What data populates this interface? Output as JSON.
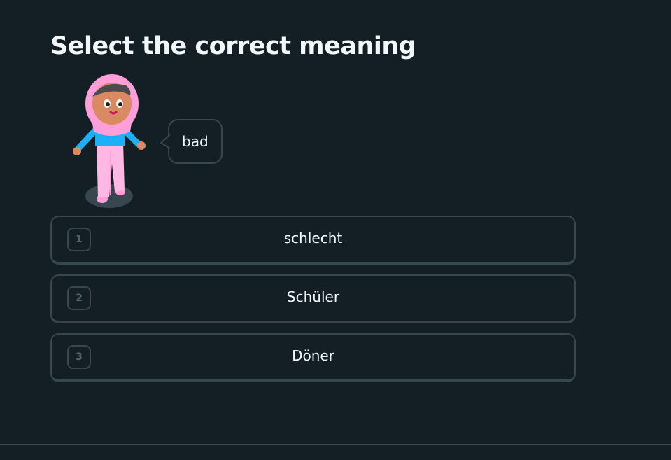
{
  "prompt": {
    "title": "Select the correct meaning"
  },
  "speech_bubble": {
    "text": "bad"
  },
  "choices": [
    {
      "number": "1",
      "label": "schlecht"
    },
    {
      "number": "2",
      "label": "Schüler"
    },
    {
      "number": "3",
      "label": "Döner"
    }
  ],
  "colors": {
    "background": "#131f24",
    "border": "#37464f",
    "text": "#f1f7fb",
    "muted": "#52656d",
    "hijab_pink": "#ff9fd9",
    "shirt_blue": "#1cb0f6"
  },
  "icons": {
    "character": "character-in-pink-hijab-icon"
  }
}
